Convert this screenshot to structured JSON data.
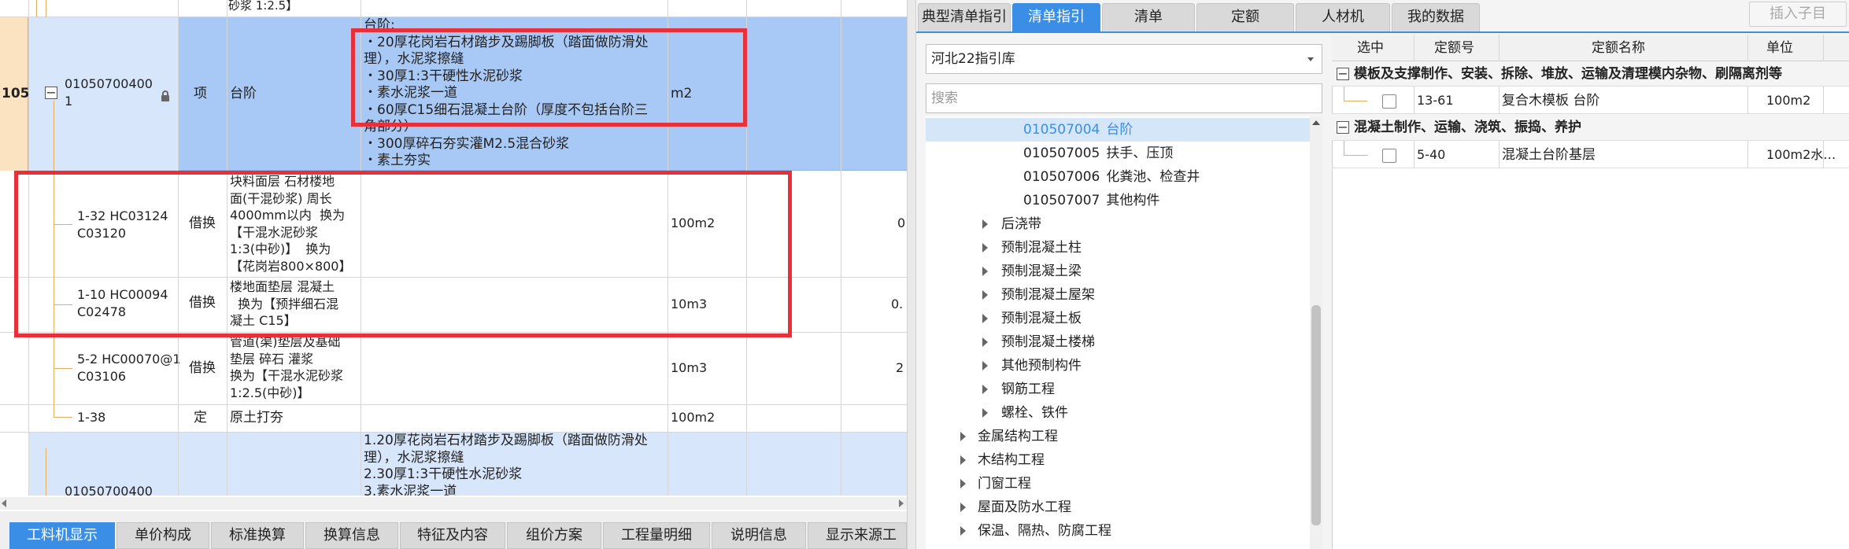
{
  "left": {
    "rows": [
      {
        "code": "",
        "type": "",
        "name": "",
        "feature": "砂浆 1:2.5】",
        "unit": "",
        "qty": ""
      },
      {
        "num": "105",
        "code": "01050700400\n1",
        "type": "项",
        "name": "台阶",
        "feature": "台阶:\n・20厚花岗岩石材踏步及踢脚板（踏面做防滑处\n理），水泥浆擦缝\n・30厚1:3干硬性水泥砂浆\n・素水泥浆一道\n・60厚C15细石混凝土台阶（厚度不包括台阶三\n角部分）\n・300厚碎石夯实灌M2.5混合砂浆\n・素土夯实",
        "unit": "m2",
        "qty": ""
      },
      {
        "code": "1-32 HC03124\nC03120",
        "type": "借换",
        "name": "块料面层 石材楼地\n面(干混砂浆) 周长\n4000mm以内  换为\n【干混水泥砂浆\n1:3(中砂)】  换为\n【花岗岩800×800】",
        "feature": "",
        "unit": "100m2",
        "qty": "0"
      },
      {
        "code": "1-10 HC00094\nC02478",
        "type": "借换",
        "name": "楼地面垫层 混凝土\n  换为【预拌细石混\n凝土 C15】",
        "feature": "",
        "unit": "10m3",
        "qty": "0."
      },
      {
        "code": "5-2 HC00070@1\nC03106",
        "type": "借换",
        "name": "管道(渠)垫层及基础\n垫层 碎石 灌浆\n换为【干混水泥砂浆\n1:2.5(中砂)】",
        "feature": "",
        "unit": "10m3",
        "qty": "2"
      },
      {
        "code": "1-38",
        "type": "定",
        "name": "原土打夯",
        "feature": "",
        "unit": "100m2",
        "qty": ""
      },
      {
        "code": "01050700400",
        "type": "项",
        "name": "台阶",
        "feature": "1.20厚花岗岩石材踏步及踢脚板（踏面做防滑处\n理），水泥浆擦缝\n2.30厚1:3干硬性水泥砂浆\n3.素水泥浆一道",
        "unit": "",
        "qty": ""
      }
    ],
    "bottom_tabs": [
      "工料机显示",
      "单价构成",
      "标准换算",
      "换算信息",
      "特征及内容",
      "组价方案",
      "工程量明细",
      "说明信息",
      "显示来源工程"
    ]
  },
  "right": {
    "tabs": [
      "典型清单指引",
      "清单指引",
      "清单",
      "定额",
      "人材机",
      "我的数据"
    ],
    "active_tab": "清单指引",
    "insert_child_label": "插入子目",
    "library_select": "河北22指引库",
    "search_placeholder": "搜索",
    "tree": [
      {
        "code": "010507004",
        "label": "台阶",
        "selected": true
      },
      {
        "code": "010507005",
        "label": "扶手、压顶"
      },
      {
        "code": "010507006",
        "label": "化粪池、检查井"
      },
      {
        "code": "010507007",
        "label": "其他构件"
      },
      {
        "label": "后浇带"
      },
      {
        "label": "预制混凝土柱"
      },
      {
        "label": "预制混凝土梁"
      },
      {
        "label": "预制混凝土屋架"
      },
      {
        "label": "预制混凝土板"
      },
      {
        "label": "预制混凝土楼梯"
      },
      {
        "label": "其他预制构件"
      },
      {
        "label": "钢筋工程"
      },
      {
        "label": "螺栓、铁件"
      },
      {
        "label": "金属结构工程"
      },
      {
        "label": "木结构工程"
      },
      {
        "label": "门窗工程"
      },
      {
        "label": "屋面及防水工程"
      },
      {
        "label": "保温、隔热、防腐工程"
      }
    ],
    "grid_headers": [
      "选中",
      "定额号",
      "定额名称",
      "单位"
    ],
    "groups": [
      {
        "title": "模板及支撑制作、安装、拆除、堆放、运输及清理模内杂物、刷隔离剂等",
        "items": [
          {
            "code": "13-61",
            "name": "复合木模板 台阶",
            "unit": "100m2"
          }
        ]
      },
      {
        "title": "混凝土制作、运输、浇筑、振捣、养护",
        "items": [
          {
            "code": "5-40",
            "name": "混凝土台阶基层",
            "unit": "100m2水…"
          }
        ]
      }
    ]
  },
  "colors": {
    "accent": "#3a8ee6",
    "highlight_row": "#a8c9f5",
    "selected_cell": "#fbe3c2",
    "annotation": "#e8303a"
  }
}
